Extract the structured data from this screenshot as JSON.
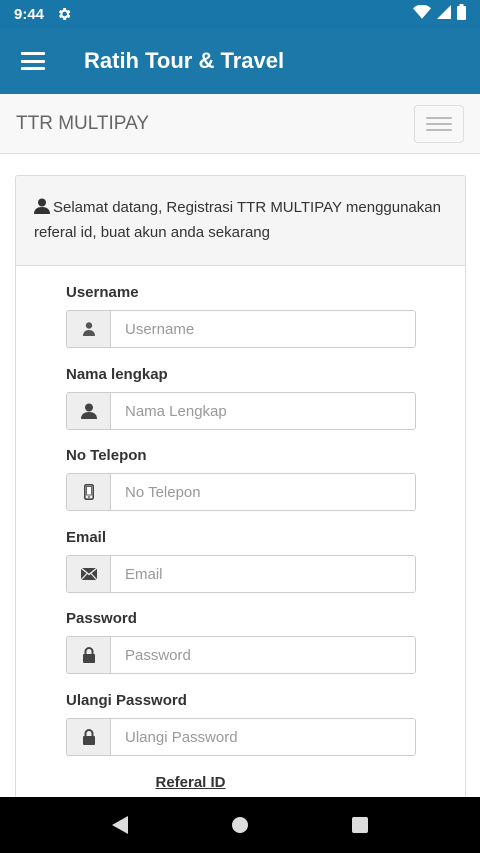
{
  "status": {
    "time": "9:44",
    "icons": [
      "settings-gear-icon",
      "wifi-icon",
      "signal-icon",
      "battery-icon"
    ]
  },
  "app_bar": {
    "title": "Ratih Tour & Travel",
    "menu_icon": "hamburger-menu-icon"
  },
  "navbar": {
    "brand": "TTR MULTIPAY",
    "toggle_icon": "navbar-toggle-icon"
  },
  "panel": {
    "heading": "Selamat datang, Registrasi TTR MULTIPAY menggunakan referal id, buat akun anda sekarang"
  },
  "form": {
    "fields": [
      {
        "label": "Username",
        "placeholder": "Username",
        "icon": "user-icon"
      },
      {
        "label": "Nama lengkap",
        "placeholder": "Nama Lengkap",
        "icon": "user-icon"
      },
      {
        "label": "No Telepon",
        "placeholder": "No Telepon",
        "icon": "phone-icon"
      },
      {
        "label": "Email",
        "placeholder": "Email",
        "icon": "envelope-icon"
      },
      {
        "label": "Password",
        "placeholder": "Password",
        "icon": "lock-icon"
      },
      {
        "label": "Ulangi Password",
        "placeholder": "Ulangi Password",
        "icon": "lock-icon"
      }
    ],
    "referal_label": "Referal ID"
  },
  "colors": {
    "app_bar": "#1b78a9",
    "status_bar": "#1976a8",
    "panel_heading_bg": "#f5f5f5",
    "addon_bg": "#eeeeee"
  }
}
